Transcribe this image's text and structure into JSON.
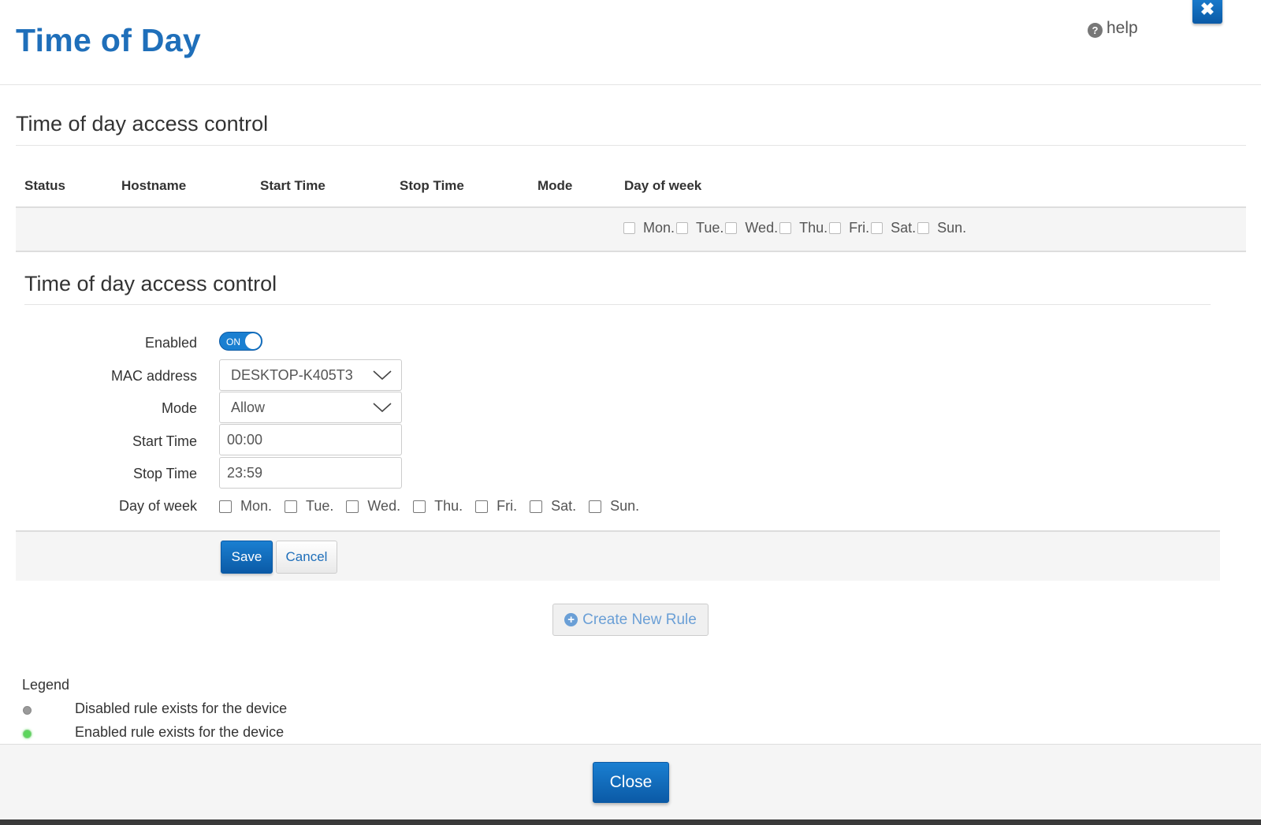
{
  "header": {
    "title": "Time of Day",
    "help_label": "help",
    "close_x": "✖"
  },
  "table_section": {
    "heading": "Time of day access control",
    "columns": [
      "Status",
      "Hostname",
      "Start Time",
      "Stop Time",
      "Mode",
      "Day of week"
    ],
    "row_days": [
      "Mon.",
      "Tue.",
      "Wed.",
      "Thu.",
      "Fri.",
      "Sat.",
      "Sun."
    ]
  },
  "form_section": {
    "heading": "Time of day access control",
    "enabled_label": "Enabled",
    "toggle_text": "ON",
    "mac_label": "MAC address",
    "mac_value": "DESKTOP-K405T3",
    "mode_label": "Mode",
    "mode_value": "Allow",
    "start_label": "Start Time",
    "start_value": "00:00",
    "stop_label": "Stop Time",
    "stop_value": "23:59",
    "days_label": "Day of week",
    "days": [
      "Mon.",
      "Tue.",
      "Wed.",
      "Thu.",
      "Fri.",
      "Sat.",
      "Sun."
    ],
    "save_label": "Save",
    "cancel_label": "Cancel"
  },
  "create_rule_label": "Create New Rule",
  "legend": {
    "title": "Legend",
    "disabled_text": "Disabled rule exists for the device",
    "enabled_text": "Enabled rule exists for the device",
    "disabled_color": "#9a9a9a",
    "enabled_color": "#5cd65c"
  },
  "footer": {
    "close_label": "Close"
  },
  "colors": {
    "accent": "#1a7fd1",
    "title": "#1f6fba"
  }
}
